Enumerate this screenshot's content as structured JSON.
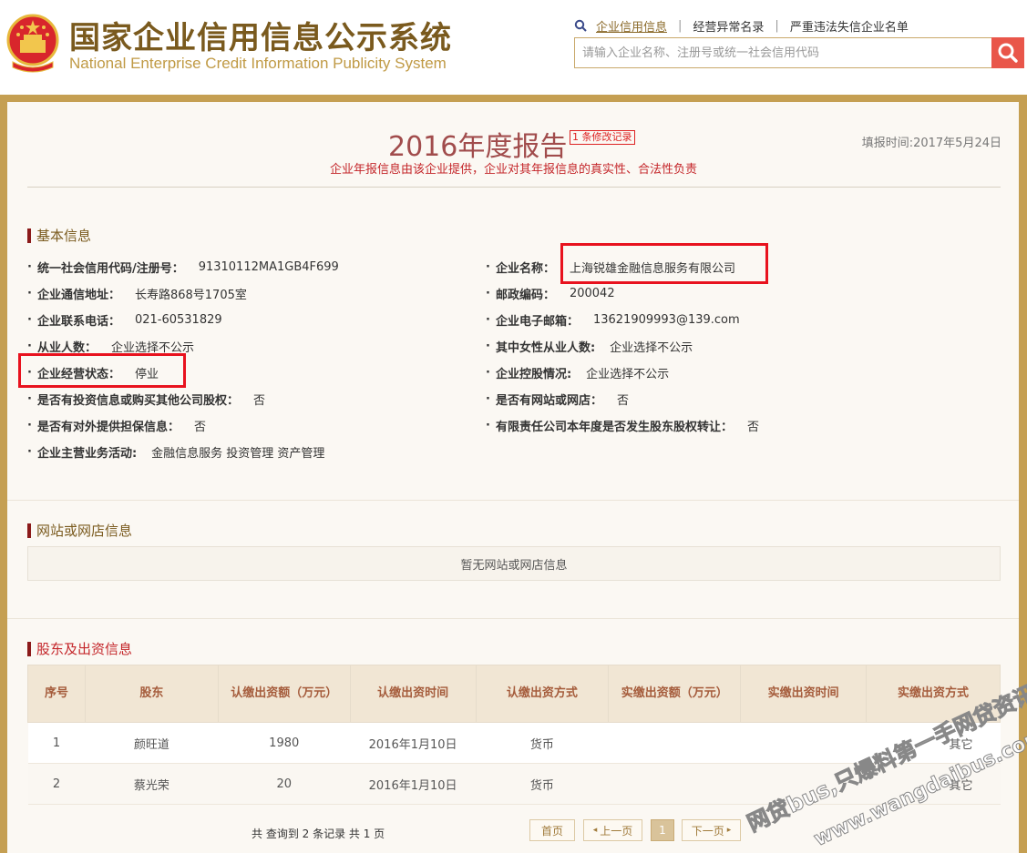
{
  "header": {
    "title_cn": "国家企业信用信息公示系统",
    "title_en": "National Enterprise Credit Information Publicity System",
    "nav": [
      "企业信用信息",
      "经营异常名录",
      "严重违法失信企业名单"
    ],
    "search_placeholder": "请输入企业名称、注册号或统一社会信用代码"
  },
  "report": {
    "title": "2016年度报告",
    "modification_link": "1 条修改记录",
    "fill_time": "填报时间:2017年5月24日",
    "disclaimer": "企业年报信息由该企业提供，企业对其年报信息的真实性、合法性负责"
  },
  "basic_info": {
    "section_title": "基本信息",
    "left": [
      {
        "label": "统一社会信用代码/注册号：",
        "value": "91310112MA1GB4F699"
      },
      {
        "label": "企业通信地址：",
        "value": "长寿路868号1705室"
      },
      {
        "label": "企业联系电话：",
        "value": "021-60531829"
      },
      {
        "label": "从业人数：",
        "value": "企业选择不公示"
      },
      {
        "label": "企业经营状态：",
        "value": "停业"
      },
      {
        "label": "是否有投资信息或购买其他公司股权：",
        "value": "否"
      },
      {
        "label": "是否有对外提供担保信息：",
        "value": "否"
      },
      {
        "label": "企业主营业务活动:",
        "value": "金融信息服务 投资管理 资产管理"
      }
    ],
    "right": [
      {
        "label": "企业名称：",
        "value": "上海锐雄金融信息服务有限公司"
      },
      {
        "label": "邮政编码：",
        "value": "200042"
      },
      {
        "label": "企业电子邮箱：",
        "value": "13621909993@139.com"
      },
      {
        "label": "其中女性从业人数:",
        "value": "企业选择不公示"
      },
      {
        "label": "企业控股情况:",
        "value": "企业选择不公示"
      },
      {
        "label": "是否有网站或网店：",
        "value": "否"
      },
      {
        "label": "有限责任公司本年度是否发生股东股权转让：",
        "value": "否"
      }
    ]
  },
  "website": {
    "section_title": "网站或网店信息",
    "empty_text": "暂无网站或网店信息"
  },
  "shareholders": {
    "section_title": "股东及出资信息",
    "headers": [
      "序号",
      "股东",
      "认缴出资额（万元）",
      "认缴出资时间",
      "认缴出资方式",
      "实缴出资额（万元）",
      "实缴出资时间",
      "实缴出资方式"
    ],
    "rows": [
      [
        "1",
        "颜旺道",
        "1980",
        "2016年1月10日",
        "货币",
        "",
        "",
        "其它"
      ],
      [
        "2",
        "蔡光荣",
        "20",
        "2016年1月10日",
        "货币",
        "",
        "",
        "其它"
      ]
    ],
    "summary": "共 查询到 2 条记录 共 1 页"
  },
  "pager": {
    "first": "首页",
    "prev": "上一页",
    "current": "1",
    "next": "下一页"
  },
  "watermark": {
    "line1": "网贷bus,只爆料第一手网贷资讯",
    "line2": "www.wangdaibus.com"
  },
  "colors": {
    "brand_gold": "#c59f52",
    "title_brown": "#7a5a1e",
    "accent_red": "#c4262a",
    "highlight_red": "#e8121e",
    "search_button": "#e9564a"
  }
}
